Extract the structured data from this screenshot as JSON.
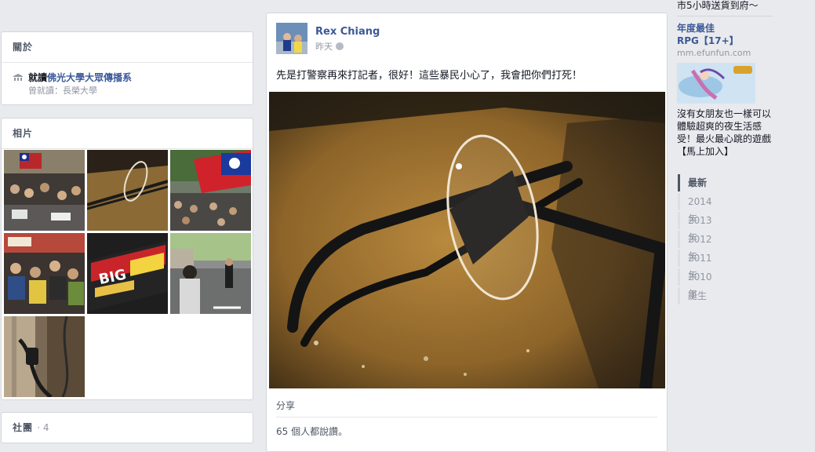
{
  "about": {
    "title": "關於",
    "edu_prefix": "就讀",
    "edu_school": "佛光大學大眾傳播系",
    "edu_previous": "曾就讀：長榮大學"
  },
  "photos": {
    "title": "相片",
    "items": [
      {
        "id": "p1",
        "icon": "photo-legislature"
      },
      {
        "id": "p2",
        "icon": "photo-broken-glasses"
      },
      {
        "id": "p3",
        "icon": "photo-flag-crowd"
      },
      {
        "id": "p4",
        "icon": "photo-seated-crowd"
      },
      {
        "id": "p5",
        "icon": "photo-snack-package"
      },
      {
        "id": "p6",
        "icon": "photo-street"
      },
      {
        "id": "p7",
        "icon": "photo-cables"
      }
    ]
  },
  "groups": {
    "title": "社團",
    "count": "· 4"
  },
  "post": {
    "author": "Rex Chiang",
    "time": "昨天",
    "text": "先是打警察再來打記者，很好！這些暴民小心了，我會把你們打死！",
    "share": "分享",
    "likes": "65 個人都說讚。"
  },
  "ad": {
    "top_text": "市5小時送貨到府～",
    "title_line1": "年度最佳",
    "title_line2": "RPG【17+】",
    "domain": "mm.efunfun.com",
    "body": "沒有女朋友也一樣可以體驗超爽的夜生活感受！最火最心跳的遊戲【馬上加入】"
  },
  "timeline": {
    "items": [
      "最新",
      "2014年",
      "2013年",
      "2012年",
      "2011年",
      "2010年",
      "誕生"
    ]
  },
  "colors": {
    "page_bg": "#e9eaed",
    "link_blue": "#3b5998",
    "muted": "#9197a3"
  }
}
